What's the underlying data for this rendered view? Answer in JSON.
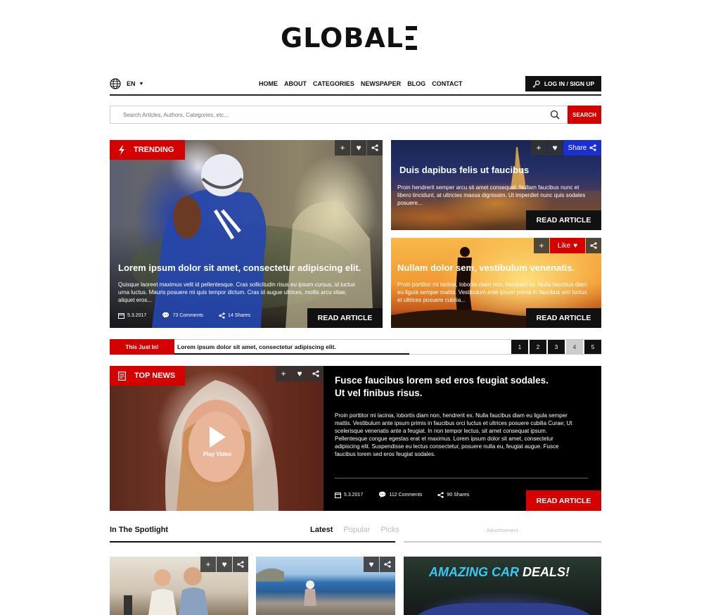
{
  "logo": {
    "text": "GLOBAL"
  },
  "nav": {
    "lang": "EN",
    "items": [
      "HOME",
      "ABOUT",
      "CATEGORIES",
      "NEWSPAPER",
      "BLOG",
      "CONTACT"
    ],
    "login": "LOG IN / SIGN UP"
  },
  "search": {
    "placeholder": "Search Articles, Authors, Categories, etc...",
    "button": "SEARCH"
  },
  "trending": {
    "tag": "TRENDING",
    "title": "Lorem ipsum dolor sit amet, consectetur adipiscing elit.",
    "text": "Quisque laoreet maximus velit id pellentesque. Cras sollicitudin risus eu ipsum cursus, id luctus urna luctus. Mauris posuere mi quis tempor dictum. Cras id augue ultrices, mollis arcu vitae, aliquet eros...",
    "date": "5.3.2017",
    "comments": "73 Comments",
    "shares": "14 Shares",
    "read": "READ ARTICLE"
  },
  "card_city": {
    "share": "Share",
    "title": "Duis dapibus felis ut faucibus",
    "text": "Proin hendrerit semper arcu sit amet consequat. Nullam faucibus nunc et libero tincidunt, at ultricies massa dignissim. Ut imperdiet nunc quis sodales posuere...",
    "read": "READ ARTICLE"
  },
  "card_sunset": {
    "like": "Like",
    "title": "Nullam dolor sem, vestibulum venenatis.",
    "text": "Proin porttitor mi lacinia, lobortis diam non, hendrerit ex. Nulla faucibus diam eu ligula semper mattis. Vestibulum ante ipsum primis in faucibus orci luctus et ultrices posuere cubilia...",
    "read": "READ ARTICLE"
  },
  "ticker": {
    "label": "This Just In!",
    "text": "Lorem ipsum dolor sit amet, consectetur adipiscing elit.",
    "pages": [
      "1",
      "2",
      "3",
      "4",
      "5"
    ],
    "active_page": "4"
  },
  "top_news": {
    "tag": "TOP NEWS",
    "play": "Play Video",
    "title1": "Fusce faucibus lorem sed eros feugiat sodales.",
    "title2": "Ut vel finibus risus.",
    "text": "Proin porttitor mi lacinia, lobortis diam non, hendrerit ex. Nulla faucibus diam eu ligula semper mattis. Vestibulum ante ipsum primis in faucibus orci luctus et ultrices posuere cubilia Curae; Ut scelerisque venenatis ante a feugiat. In non tempor lectus, sit amet consequat ipsum. Pellentesque congue egestas erat et maximus. Lorem ipsum dolor sit amet, consectetur adipiscing elit. Suspendisse eu lectus consectetur, posuere nulla eu, feugiat augue. Fusce faucibus lorem sed eros feugiat sodales.",
    "date": "5.3.2017",
    "comments": "112 Comments",
    "shares": "90 Shares",
    "read": "READ ARTICLE"
  },
  "spotlight": {
    "title": "In The Spotlight",
    "tabs": [
      "Latest",
      "Popular",
      "Picks"
    ],
    "advert": "- Advertisement -",
    "ad_text1": "AMAZING CAR",
    "ad_text2": "DEALS!"
  },
  "colors": {
    "accent": "#d50000",
    "dark": "#111111",
    "share_blue": "#1a2fd0"
  }
}
